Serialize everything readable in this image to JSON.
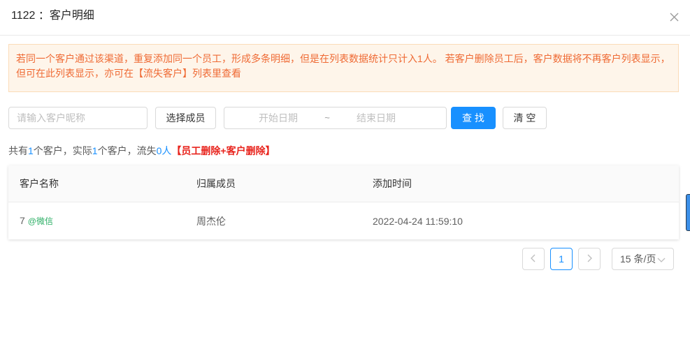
{
  "dialog": {
    "title": "1122 ：客户明细"
  },
  "alert": {
    "line1": "若同一个客户通过该渠道，重复添加同一个员工，形成多条明细，但是在列表数据统计只计入1人。 若客户删除员工后，客户数据将不再客户列表显示，",
    "line2": "但可在此列表显示，亦可在【流失客户】列表里查看"
  },
  "filters": {
    "nickname_placeholder": "请输入客户昵称",
    "select_member_label": "选择成员",
    "start_date_placeholder": "开始日期",
    "range_separator": "~",
    "end_date_placeholder": "结束日期",
    "search_label": "查 找",
    "clear_label": "清 空"
  },
  "summary": {
    "prefix": "共有",
    "total": "1",
    "text_actual": "个客户，实际",
    "actual": "1",
    "text_lost": "个客户，流失",
    "lost": "0人",
    "note": "【员工删除+客户删除】"
  },
  "table": {
    "columns": [
      "客户名称",
      "归属成员",
      "添加时间"
    ],
    "rows": [
      {
        "name": "7",
        "source": "@微信",
        "member": "周杰伦",
        "added_at": "2022-04-24 11:59:10"
      }
    ]
  },
  "pagination": {
    "pages": [
      {
        "label": "1",
        "active": true
      }
    ],
    "page_size": "15 条/页"
  },
  "icons": {
    "close": "close-icon",
    "prev_page": "chevron-left-icon",
    "next_page": "chevron-right-icon",
    "page_size_dropdown": "chevron-down-icon"
  },
  "colors": {
    "primary": "#1890ff",
    "alert_text": "#ef6a34",
    "alert_background": "#fef5ea",
    "alert_border": "#fbdcb8",
    "danger": "#e8231c",
    "wechat_green": "#2bae64"
  }
}
